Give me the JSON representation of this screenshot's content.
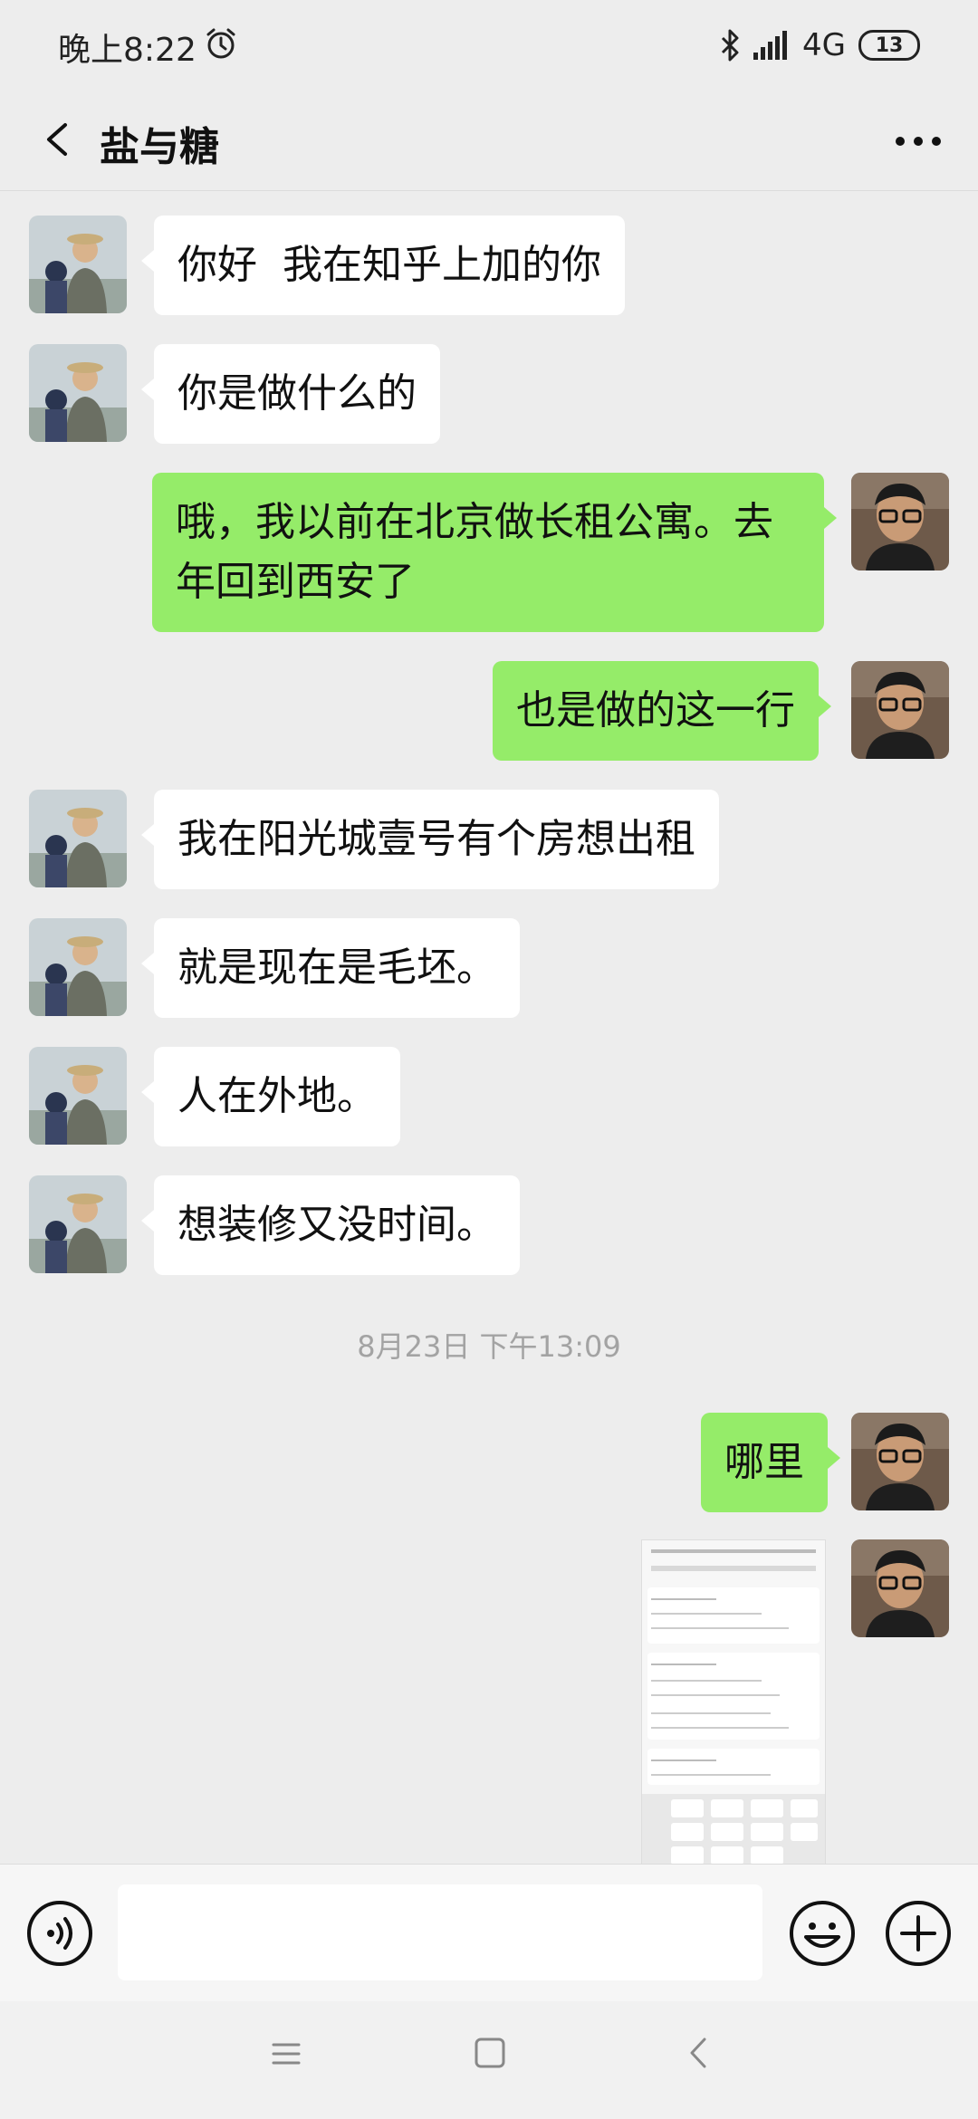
{
  "status_bar": {
    "time": "晚上8:22",
    "network": "4G",
    "battery": "13"
  },
  "header": {
    "title": "盐与糖"
  },
  "messages": [
    {
      "side": "in",
      "text": "你好  我在知乎上加的你"
    },
    {
      "side": "in",
      "text": "你是做什么的"
    },
    {
      "side": "out",
      "text": "哦，我以前在北京做长租公寓。去年回到西安了"
    },
    {
      "side": "out",
      "text": "也是做的这一行"
    },
    {
      "side": "in",
      "text": "我在阳光城壹号有个房想出租"
    },
    {
      "side": "in",
      "text": "就是现在是毛坯。"
    },
    {
      "side": "in",
      "text": "人在外地。"
    },
    {
      "side": "in",
      "text": "想装修又没时间。"
    },
    {
      "side": "out",
      "text": "哪里"
    }
  ],
  "timestamp": "8月23日 下午13:09",
  "input": {
    "value": "",
    "placeholder": ""
  },
  "colors": {
    "outgoing_bubble": "#95ec69",
    "incoming_bubble": "#ffffff",
    "background": "#ededed"
  },
  "icons": [
    "alarm-icon",
    "bluetooth-icon",
    "signal-icon",
    "back-icon",
    "more-icon",
    "voice-icon",
    "emoji-icon",
    "plus-icon",
    "nav-menu-icon",
    "nav-home-icon",
    "nav-back-icon"
  ]
}
